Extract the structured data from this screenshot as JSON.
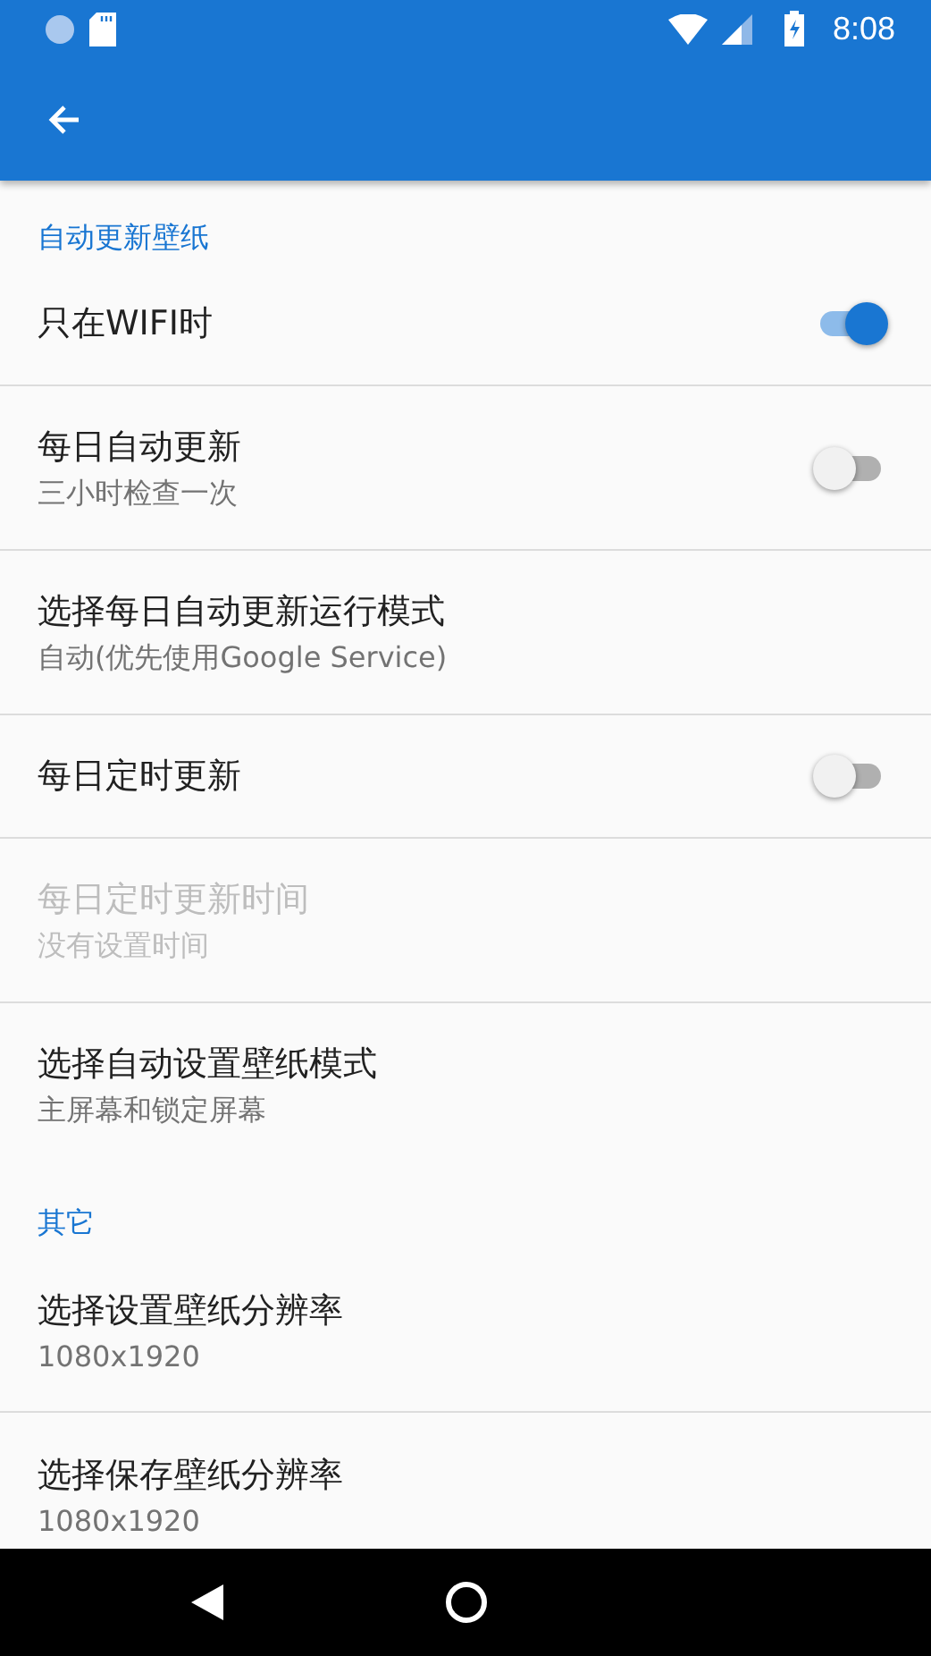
{
  "status_bar": {
    "time": "8:08"
  },
  "sections": [
    {
      "header": "自动更新壁纸",
      "items": [
        {
          "kind": "switch",
          "title": "只在WIFI时",
          "on": true,
          "disabled": false
        },
        {
          "kind": "switch",
          "title": "每日自动更新",
          "summary": "三小时检查一次",
          "on": false,
          "disabled": false
        },
        {
          "kind": "plain",
          "title": "选择每日自动更新运行模式",
          "summary": "自动(优先使用Google Service)",
          "disabled": false
        },
        {
          "kind": "switch",
          "title": "每日定时更新",
          "on": false,
          "disabled": false
        },
        {
          "kind": "plain",
          "title": "每日定时更新时间",
          "summary": "没有设置时间",
          "disabled": true
        },
        {
          "kind": "plain",
          "title": "选择自动设置壁纸模式",
          "summary": "主屏幕和锁定屏幕",
          "disabled": false
        }
      ]
    },
    {
      "header": "其它",
      "items": [
        {
          "kind": "plain",
          "title": "选择设置壁纸分辨率",
          "summary": "1080x1920",
          "disabled": false
        },
        {
          "kind": "plain",
          "title": "选择保存壁纸分辨率",
          "summary": "1080x1920",
          "disabled": false
        }
      ]
    }
  ]
}
